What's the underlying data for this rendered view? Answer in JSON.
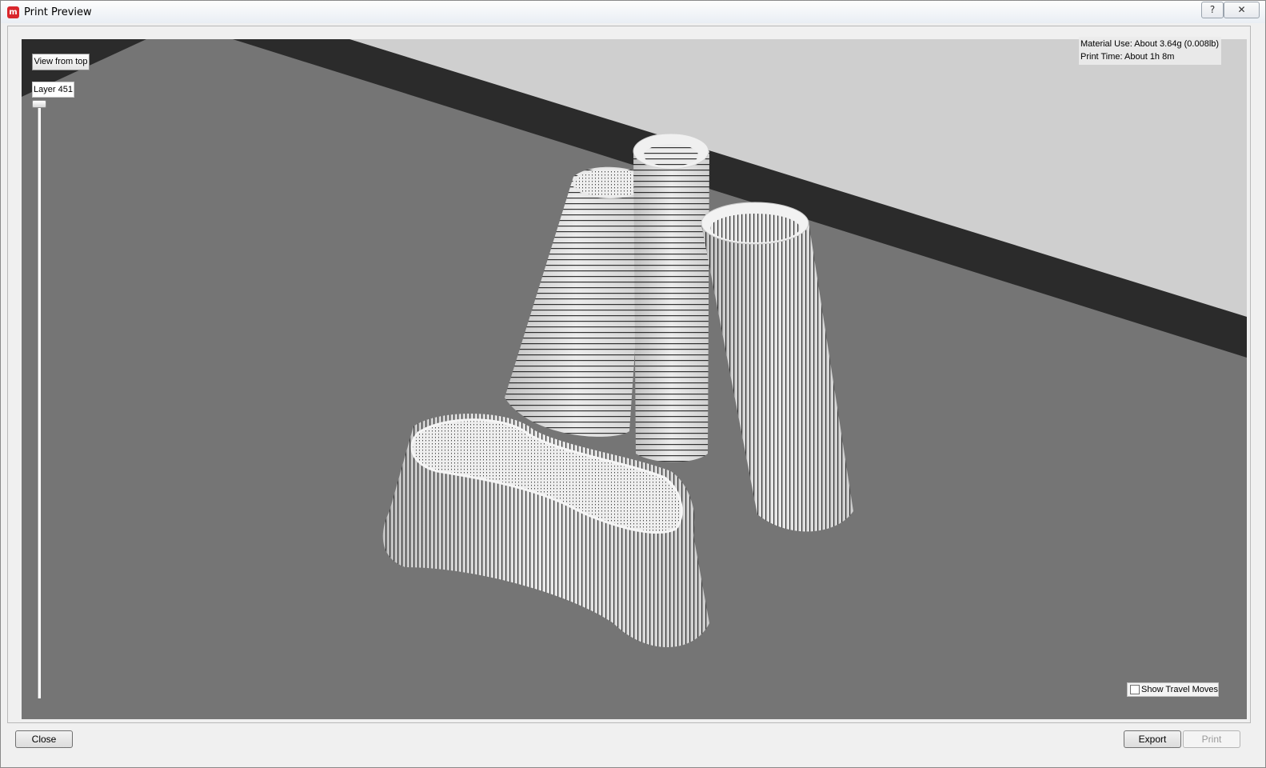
{
  "window": {
    "title": "Print Preview",
    "app_icon": "makerware-icon",
    "help_label": "?",
    "close_glyph": "✕"
  },
  "controls": {
    "view_from_top_label": "View from top",
    "layer_label": "Layer 451",
    "layer_slider": {
      "value": 451,
      "position_fraction": 1.0
    }
  },
  "stats": {
    "material_use": "Material Use: About 3.64g (0.008lb)",
    "print_time": "Print Time: About 1h 8m"
  },
  "travel": {
    "label": "Show Travel Moves",
    "checked": false
  },
  "buttons": {
    "close_label": "Close",
    "export_label": "Export",
    "print_label": "Print",
    "print_enabled": false
  },
  "colors": {
    "floor": "#757575",
    "wall": "#cfcfcf",
    "wall_edge": "#2b2b2b",
    "model_fill": "#e8e8e8",
    "model_stripes": "#1c1c1c",
    "accent_icon": "#d9262c"
  }
}
